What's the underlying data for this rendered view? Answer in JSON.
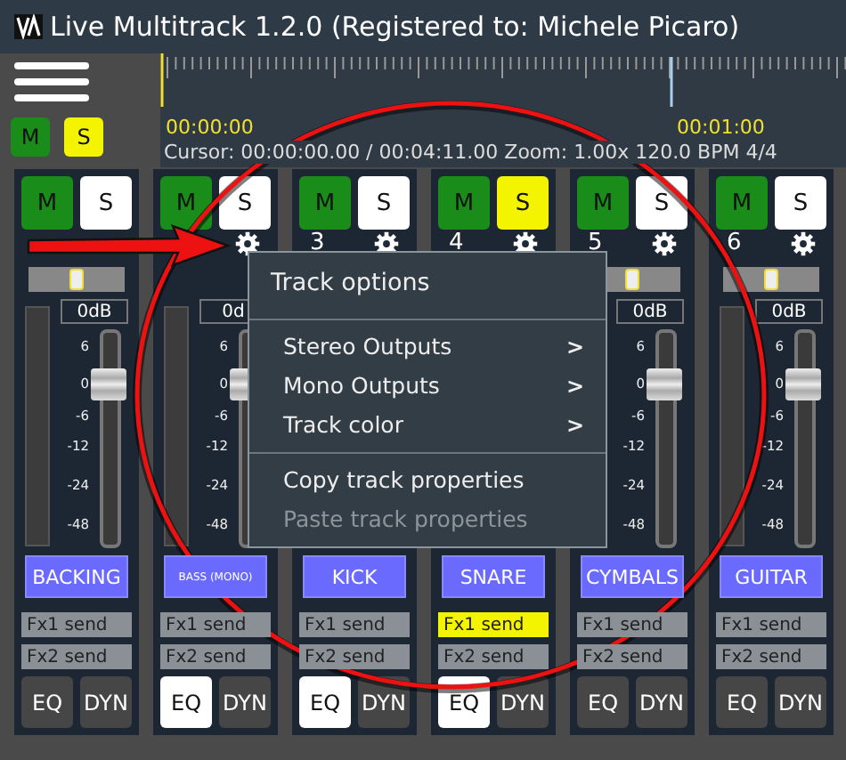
{
  "window": {
    "title": "Live Multitrack 1.2.0 (Registered to: Michele Picaro)"
  },
  "master": {
    "mute_label": "M",
    "solo_label": "S",
    "solo": true
  },
  "timeline": {
    "markers": [
      "00:00:00",
      "00:01:00"
    ],
    "status": "Cursor: 00:00:00.00 / 00:04:11.00 Zoom: 1.00x 120.0 BPM 4/4"
  },
  "tracks": [
    {
      "mute_label": "M",
      "solo_label": "S",
      "solo": false,
      "pan": {
        "level": 0.5
      },
      "meter": true,
      "gain": "0dB",
      "scale": [
        "6",
        "0",
        "-6",
        "-12",
        "-24",
        "-48"
      ],
      "fader": {
        "level": 0.75
      },
      "name": "BACKING",
      "small_name": false,
      "sends": [
        {
          "label": "Fx1 send",
          "active": false
        },
        {
          "label": "Fx2 send",
          "active": false
        }
      ],
      "eq_label": "EQ",
      "eq_on": false,
      "dyn_label": "DYN"
    },
    {
      "mute_label": "M",
      "solo_label": "S",
      "solo": false,
      "gear": true,
      "meter": true,
      "gain": "0d",
      "scale": [
        "6",
        "0",
        "-6",
        "-12",
        "-24",
        "-48"
      ],
      "fader": {
        "level": 0.75
      },
      "name": "BASS (MONO)",
      "small_name": true,
      "sends": [
        {
          "label": "Fx1 send",
          "active": false
        },
        {
          "label": "Fx2 send",
          "active": false
        }
      ],
      "eq_label": "EQ",
      "eq_on": true,
      "dyn_label": "DYN"
    },
    {
      "mute_label": "M",
      "solo_label": "S",
      "solo": false,
      "number": "3",
      "gear": true,
      "name": "KICK",
      "small_name": false,
      "sends": [
        {
          "label": "Fx1 send",
          "active": false
        },
        {
          "label": "Fx2 send",
          "active": false
        }
      ],
      "eq_label": "EQ",
      "eq_on": true,
      "dyn_label": "DYN"
    },
    {
      "mute_label": "M",
      "solo_label": "S",
      "solo": true,
      "number": "4",
      "gear": true,
      "name": "SNARE",
      "small_name": false,
      "sends": [
        {
          "label": "Fx1 send",
          "active": true
        },
        {
          "label": "Fx2 send",
          "active": false
        }
      ],
      "eq_label": "EQ",
      "eq_on": true,
      "dyn_label": "DYN"
    },
    {
      "mute_label": "M",
      "solo_label": "S",
      "solo": false,
      "number": "5",
      "gear": true,
      "pan": {
        "level": 0.5
      },
      "gain": "0dB",
      "scale": [
        "6",
        "0",
        "-6",
        "-12",
        "-24",
        "-48"
      ],
      "fader": {
        "level": 0.75
      },
      "name": "CYMBALS",
      "small_name": false,
      "sends": [
        {
          "label": "Fx1 send",
          "active": false
        },
        {
          "label": "Fx2 send",
          "active": false
        }
      ],
      "eq_label": "EQ",
      "eq_on": false,
      "dyn_label": "DYN"
    },
    {
      "mute_label": "M",
      "solo_label": "S",
      "solo": false,
      "number": "6",
      "gear": true,
      "pan": {
        "level": 0.5
      },
      "meter": true,
      "gain": "0dB",
      "scale": [
        "6",
        "0",
        "-6",
        "-12",
        "-24",
        "-48"
      ],
      "fader": {
        "level": 0.75
      },
      "name": "GUITAR",
      "small_name": false,
      "sends": [
        {
          "label": "Fx1 send",
          "active": false
        },
        {
          "label": "Fx2 send",
          "active": false
        }
      ],
      "eq_label": "EQ",
      "eq_on": false,
      "dyn_label": "DYN"
    }
  ],
  "context_menu": {
    "title": "Track options",
    "items": [
      {
        "label": "Stereo Outputs",
        "kind": "submenu",
        "disabled": false
      },
      {
        "label": "Mono Outputs",
        "kind": "submenu",
        "disabled": false
      },
      {
        "label": "Track color",
        "kind": "submenu",
        "disabled": false
      },
      {
        "kind": "separator"
      },
      {
        "label": "Copy track properties",
        "kind": "action",
        "disabled": false
      },
      {
        "label": "Paste track properties",
        "kind": "action",
        "disabled": true
      }
    ],
    "submenu_glyph": ">"
  }
}
